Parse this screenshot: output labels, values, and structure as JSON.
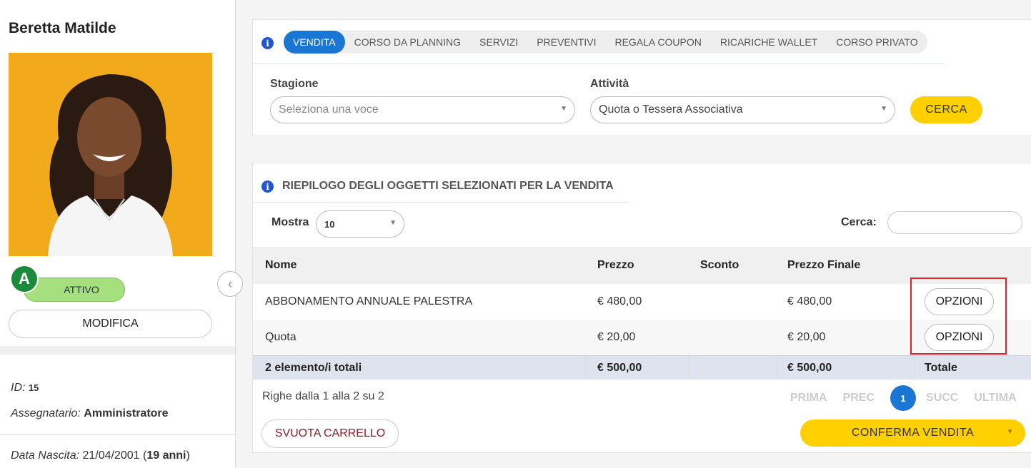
{
  "profile": {
    "name": "Beretta Matilde",
    "badge": "A",
    "status": "ATTIVO",
    "edit_label": "MODIFICA",
    "id_label": "ID:",
    "id_value": "15",
    "assignee_label": "Assegnatario:",
    "assignee_value": "Amministratore",
    "birth_label": "Data Nascita:",
    "birth_value": "21/04/2001 (",
    "age_value": "19 anni",
    "age_close": ")"
  },
  "tabs": [
    "VENDITA",
    "CORSO DA PLANNING",
    "SERVIZI",
    "PREVENTIVI",
    "REGALA COUPON",
    "RICARICHE WALLET",
    "CORSO PRIVATO"
  ],
  "search_form": {
    "season_label": "Stagione",
    "season_placeholder": "Seleziona una voce",
    "activity_label": "Attività",
    "activity_value": "Quota o Tessera Associativa",
    "search_button": "CERCA"
  },
  "summary": {
    "title": "RIEPILOGO DEGLI OGGETTI SELEZIONATI PER LA VENDITA",
    "show_label": "Mostra",
    "show_value": "10",
    "search_label": "Cerca:",
    "columns": [
      "Nome",
      "Prezzo",
      "Sconto",
      "Prezzo Finale"
    ],
    "rows": [
      {
        "nome": "ABBONAMENTO ANNUALE PALESTRA",
        "prezzo": "€ 480,00",
        "sconto": "",
        "finale": "€ 480,00",
        "action": "OPZIONI"
      },
      {
        "nome": "Quota",
        "prezzo": "€ 20,00",
        "sconto": "",
        "finale": "€ 20,00",
        "action": "OPZIONI"
      }
    ],
    "totals": {
      "nome": "2 elemento/i totali",
      "prezzo": "€ 500,00",
      "finale": "€ 500,00",
      "label": "Totale"
    },
    "rows_info": "Righe dalla 1 alla 2 su 2",
    "pager": {
      "first": "PRIMA",
      "prev": "PREC",
      "current": "1",
      "next": "SUCC",
      "last": "ULTIMA"
    },
    "empty_cart": "SVUOTA CARRELLO",
    "confirm": "CONFERMA VENDITA"
  },
  "colors": {
    "accent_blue": "#1976d2",
    "yellow": "#ffd000",
    "active_green": "#a6e07e",
    "highlight_red": "#e0202a"
  }
}
